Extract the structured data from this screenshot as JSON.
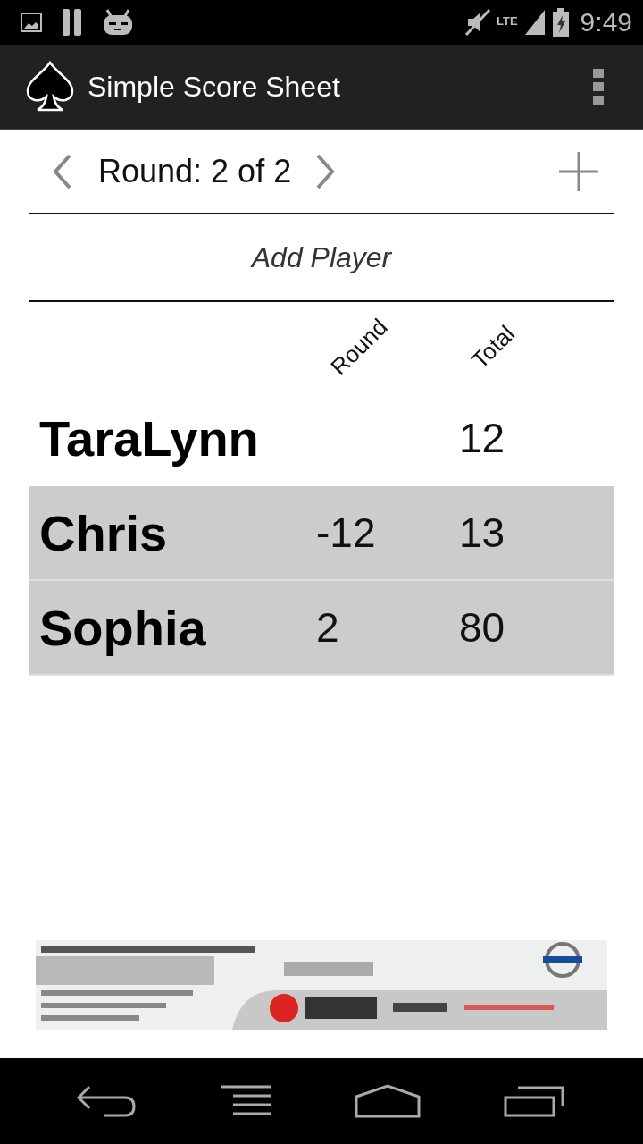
{
  "status_bar": {
    "time": "9:49",
    "network": "LTE"
  },
  "app_bar": {
    "title": "Simple Score Sheet"
  },
  "round_nav": {
    "label": "Round: 2 of 2"
  },
  "add_player": {
    "label": "Add Player"
  },
  "table": {
    "columns": [
      "Round",
      "Total"
    ],
    "rows": [
      {
        "name": "TaraLynn",
        "round": "",
        "total": "12",
        "shaded": false
      },
      {
        "name": "Chris",
        "round": "-12",
        "total": "13",
        "shaded": true
      },
      {
        "name": "Sophia",
        "round": "2",
        "total": "80",
        "shaded": true
      }
    ]
  }
}
